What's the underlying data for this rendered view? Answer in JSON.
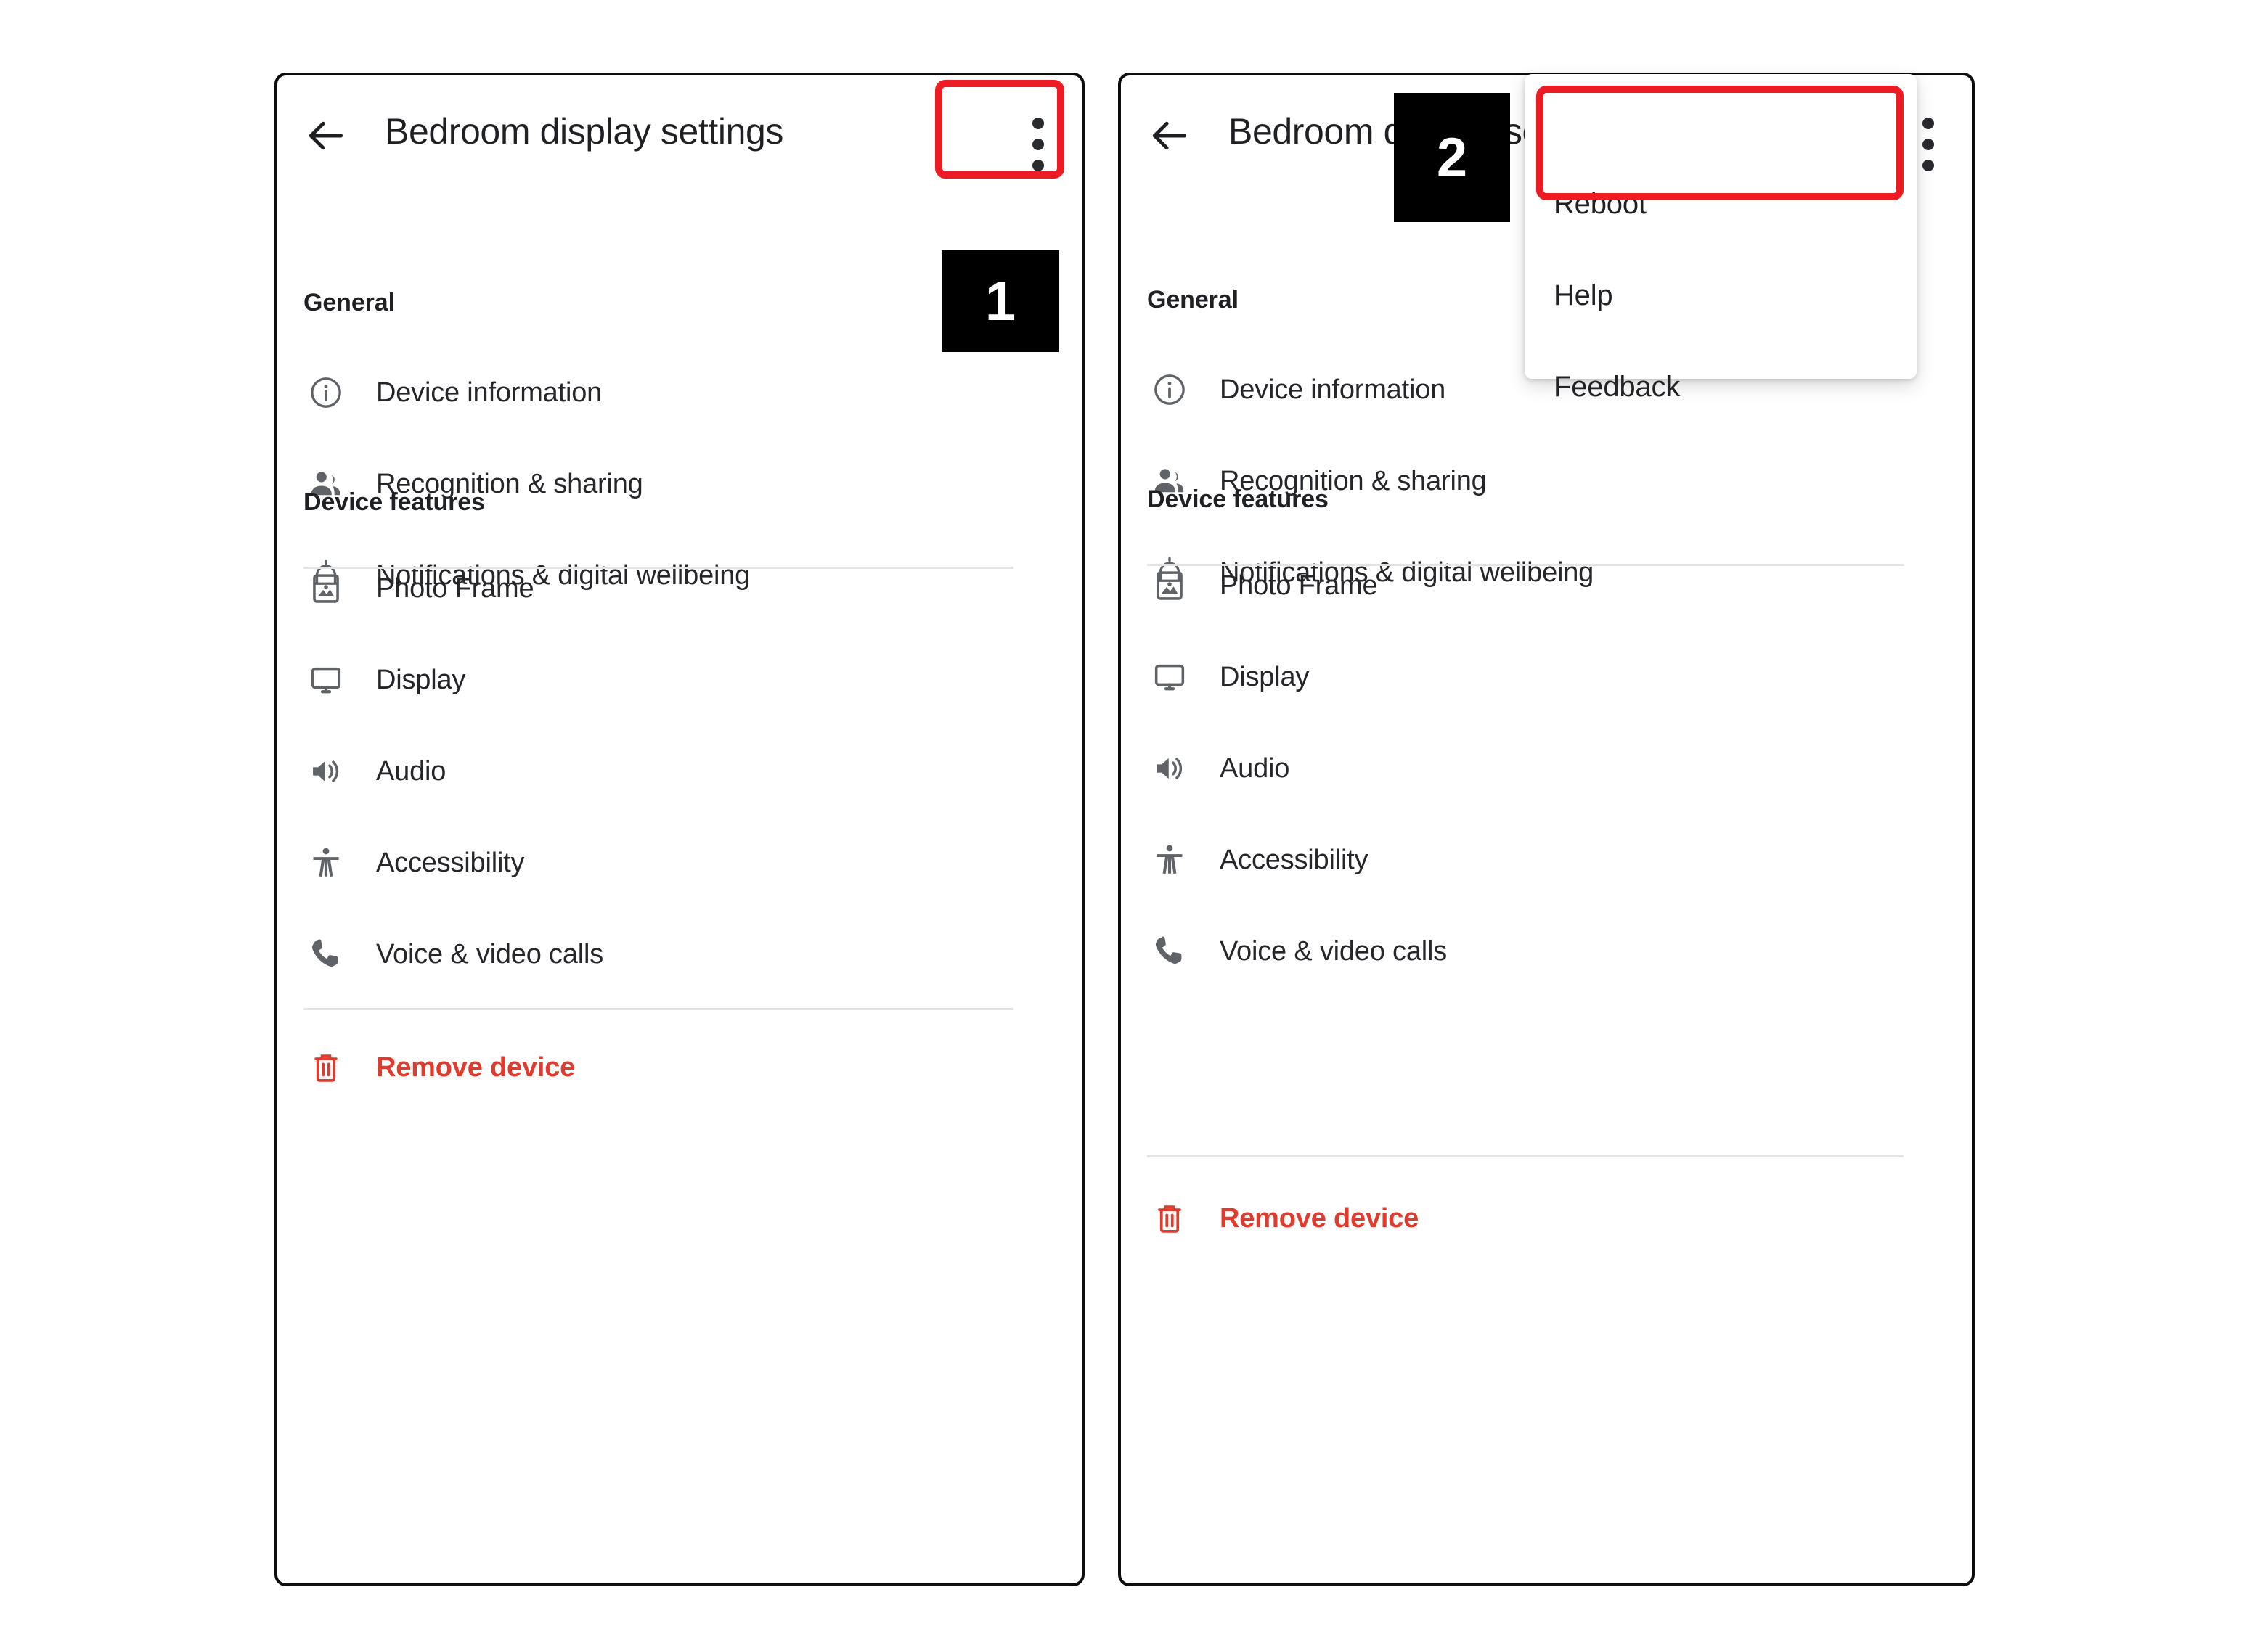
{
  "panels": [
    {
      "id": "left",
      "header": {
        "back_icon": "back-arrow-icon",
        "title": "Bedroom display settings",
        "overflow_icon": "kebab-menu-icon"
      },
      "sections": [
        {
          "title": "General",
          "items": [
            {
              "icon": "info-icon",
              "label": "Device information"
            },
            {
              "icon": "people-icon",
              "label": "Recognition & sharing"
            },
            {
              "icon": "bell-icon",
              "label": "Notifications & digital wellbeing"
            }
          ]
        },
        {
          "title": "Device features",
          "items": [
            {
              "icon": "photo-icon",
              "label": "Photo Frame"
            },
            {
              "icon": "monitor-icon",
              "label": "Display"
            },
            {
              "icon": "speaker-icon",
              "label": "Audio"
            },
            {
              "icon": "accessibility-icon",
              "label": "Accessibility"
            },
            {
              "icon": "phone-icon",
              "label": "Voice & video calls"
            }
          ]
        }
      ],
      "remove": {
        "icon": "trash-icon",
        "label": "Remove device"
      }
    },
    {
      "id": "right",
      "header": {
        "back_icon": "back-arrow-icon",
        "title": "Bedroom display settings",
        "overflow_icon": "kebab-menu-icon"
      },
      "sections": [
        {
          "title": "General",
          "items": [
            {
              "icon": "info-icon",
              "label": "Device information"
            },
            {
              "icon": "people-icon",
              "label": "Recognition & sharing"
            },
            {
              "icon": "bell-icon",
              "label": "Notifications & digital wellbeing"
            }
          ]
        },
        {
          "title": "Device features",
          "items": [
            {
              "icon": "photo-icon",
              "label": "Photo Frame"
            },
            {
              "icon": "monitor-icon",
              "label": "Display"
            },
            {
              "icon": "speaker-icon",
              "label": "Audio"
            },
            {
              "icon": "accessibility-icon",
              "label": "Accessibility"
            },
            {
              "icon": "phone-icon",
              "label": "Voice & video calls"
            }
          ]
        }
      ],
      "remove": {
        "icon": "trash-icon",
        "label": "Remove device"
      }
    }
  ],
  "dropdown": {
    "items": [
      {
        "label": "Reboot",
        "highlighted": true
      },
      {
        "label": "Help",
        "highlighted": false
      },
      {
        "label": "Feedback",
        "highlighted": false
      }
    ]
  },
  "annotations": {
    "step_badges": [
      {
        "number": "1",
        "target": "kebab-menu-icon"
      },
      {
        "number": "2",
        "target": "reboot-menu-item"
      }
    ],
    "highlight_color": "#ed1c24"
  },
  "colors": {
    "danger": "#e03c2d",
    "icon": "#5f6368",
    "text": "#25262a",
    "divider": "#e3e4e6",
    "panel_border": "#0d0d0d",
    "badge_bg": "#000000"
  }
}
